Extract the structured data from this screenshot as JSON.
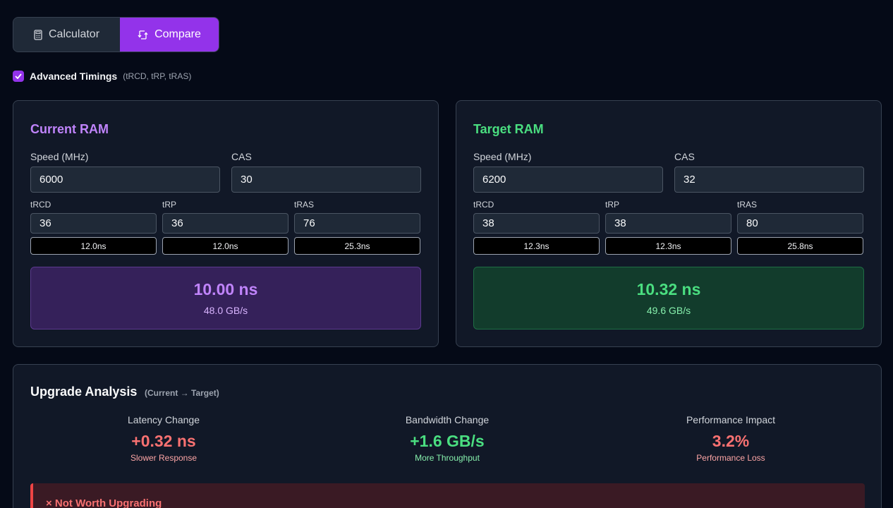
{
  "tabs": {
    "calculator": "Calculator",
    "compare": "Compare"
  },
  "advanced": {
    "label": "Advanced Timings",
    "hint": "(tRCD, tRP, tRAS)",
    "checked": true
  },
  "current": {
    "title": "Current RAM",
    "speed_label": "Speed (MHz)",
    "speed": "6000",
    "cas_label": "CAS",
    "cas": "30",
    "trcd_label": "tRCD",
    "trcd": "36",
    "trcd_ns": "12.0ns",
    "trp_label": "tRP",
    "trp": "36",
    "trp_ns": "12.0ns",
    "tras_label": "tRAS",
    "tras": "76",
    "tras_ns": "25.3ns",
    "latency": "10.00 ns",
    "bandwidth": "48.0 GB/s"
  },
  "target": {
    "title": "Target RAM",
    "speed_label": "Speed (MHz)",
    "speed": "6200",
    "cas_label": "CAS",
    "cas": "32",
    "trcd_label": "tRCD",
    "trcd": "38",
    "trcd_ns": "12.3ns",
    "trp_label": "tRP",
    "trp": "38",
    "trp_ns": "12.3ns",
    "tras_label": "tRAS",
    "tras": "80",
    "tras_ns": "25.8ns",
    "latency": "10.32 ns",
    "bandwidth": "49.6 GB/s"
  },
  "analysis": {
    "title": "Upgrade Analysis",
    "subtitle": "(Current → Target)",
    "latency": {
      "label": "Latency Change",
      "value": "+0.32 ns",
      "note": "Slower Response"
    },
    "bandwidth": {
      "label": "Bandwidth Change",
      "value": "+1.6 GB/s",
      "note": "More Throughput"
    },
    "performance": {
      "label": "Performance Impact",
      "value": "3.2%",
      "note": "Performance Loss"
    },
    "verdict": "× Not Worth Upgrading"
  },
  "colors": {
    "accent": "#9333ea",
    "current": "#c084fc",
    "target": "#4ade80",
    "negative": "#f87171"
  }
}
